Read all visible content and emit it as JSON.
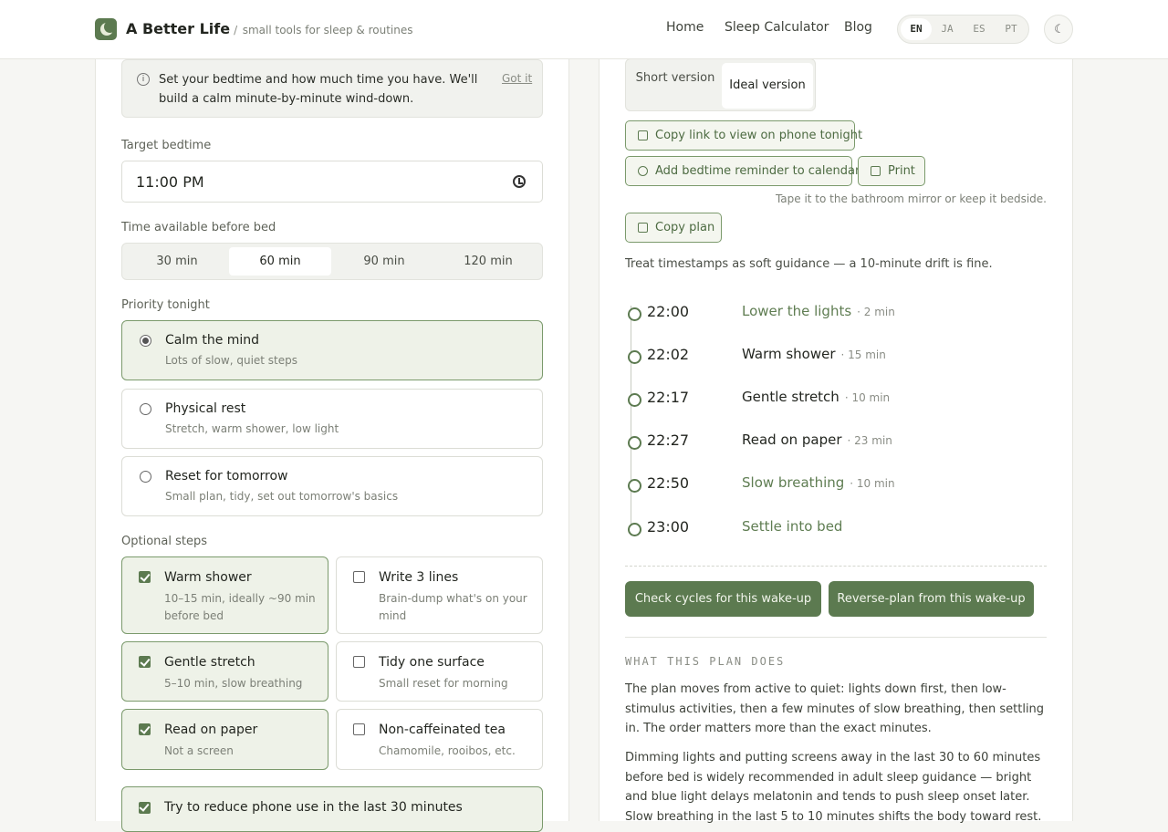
{
  "header": {
    "brand": "A Better Life",
    "brand_sep": "/",
    "brand_sub": "small tools for sleep & routines",
    "nav": [
      "Home",
      "Sleep Calculator",
      "Blog"
    ],
    "langs": [
      "EN",
      "JA",
      "ES",
      "PT"
    ],
    "active_lang": "EN"
  },
  "form": {
    "info_text": "Set your bedtime and how much time you have. We'll build a calm minute-by-minute wind-down.",
    "got_it": "Got it",
    "bedtime_label": "Target bedtime",
    "bedtime_value": "11:00 PM",
    "time_label": "Time available before bed",
    "time_options": [
      "30 min",
      "60 min",
      "90 min",
      "120 min"
    ],
    "time_selected": "60 min",
    "priority_label": "Priority tonight",
    "priorities": [
      {
        "title": "Calm the mind",
        "desc": "Lots of slow, quiet steps"
      },
      {
        "title": "Physical rest",
        "desc": "Stretch, warm shower, low light"
      },
      {
        "title": "Reset for tomorrow",
        "desc": "Small plan, tidy, set out tomorrow's basics"
      }
    ],
    "optional_label": "Optional steps",
    "optional": [
      {
        "title": "Warm shower",
        "desc": "10–15 min, ideally ~90 min before bed",
        "checked": true
      },
      {
        "title": "Write 3 lines",
        "desc": "Brain-dump what's on your mind",
        "checked": false
      },
      {
        "title": "Gentle stretch",
        "desc": "5–10 min, slow breathing",
        "checked": true
      },
      {
        "title": "Tidy one surface",
        "desc": "Small reset for morning",
        "checked": false
      },
      {
        "title": "Read on paper",
        "desc": "Not a screen",
        "checked": true
      },
      {
        "title": "Non-caffeinated tea",
        "desc": "Chamomile, rooibos, etc.",
        "checked": false
      }
    ],
    "phone_option": "Try to reduce phone use in the last 30 minutes"
  },
  "plan": {
    "version_short": "Short version",
    "version_ideal": "Ideal version",
    "copy_link": "Copy link to view on phone tonight",
    "add_reminder": "Add bedtime reminder to calendar",
    "print": "Print",
    "tape_hint": "Tape it to the bathroom mirror or keep it bedside.",
    "copy_plan": "Copy plan",
    "guidance": "Treat timestamps as soft guidance — a 10-minute drift is fine.",
    "timeline": [
      {
        "time": "22:00",
        "activity": "Lower the lights",
        "duration": "· 2 min",
        "color": "#5f7d52"
      },
      {
        "time": "22:02",
        "activity": "Warm shower",
        "duration": "· 15 min",
        "color": "#232620"
      },
      {
        "time": "22:17",
        "activity": "Gentle stretch",
        "duration": "· 10 min",
        "color": "#232620"
      },
      {
        "time": "22:27",
        "activity": "Read on paper",
        "duration": "· 23 min",
        "color": "#232620"
      },
      {
        "time": "22:50",
        "activity": "Slow breathing",
        "duration": "· 10 min",
        "color": "#5f7d52"
      },
      {
        "time": "23:00",
        "activity": "Settle into bed",
        "duration": "",
        "color": "#5f7d52"
      }
    ],
    "check_cycles": "Check cycles for this wake-up",
    "reverse_plan": "Reverse-plan from this wake-up",
    "section_title": "WHAT THIS PLAN DOES",
    "para1": "The plan moves from active to quiet: lights down first, then low-stimulus activities, then a few minutes of slow breathing, then settling in. The order matters more than the exact minutes.",
    "para2": "Dimming lights and putting screens away in the last 30 to 60 minutes before bed is widely recommended in adult sleep guidance — bright and blue light delays melatonin and tends to push sleep onset later. Slow breathing in the last 5 to 10 minutes shifts the body toward rest."
  },
  "colors": {
    "accent": "#5c7a50",
    "accent_light": "#eef2e8"
  }
}
